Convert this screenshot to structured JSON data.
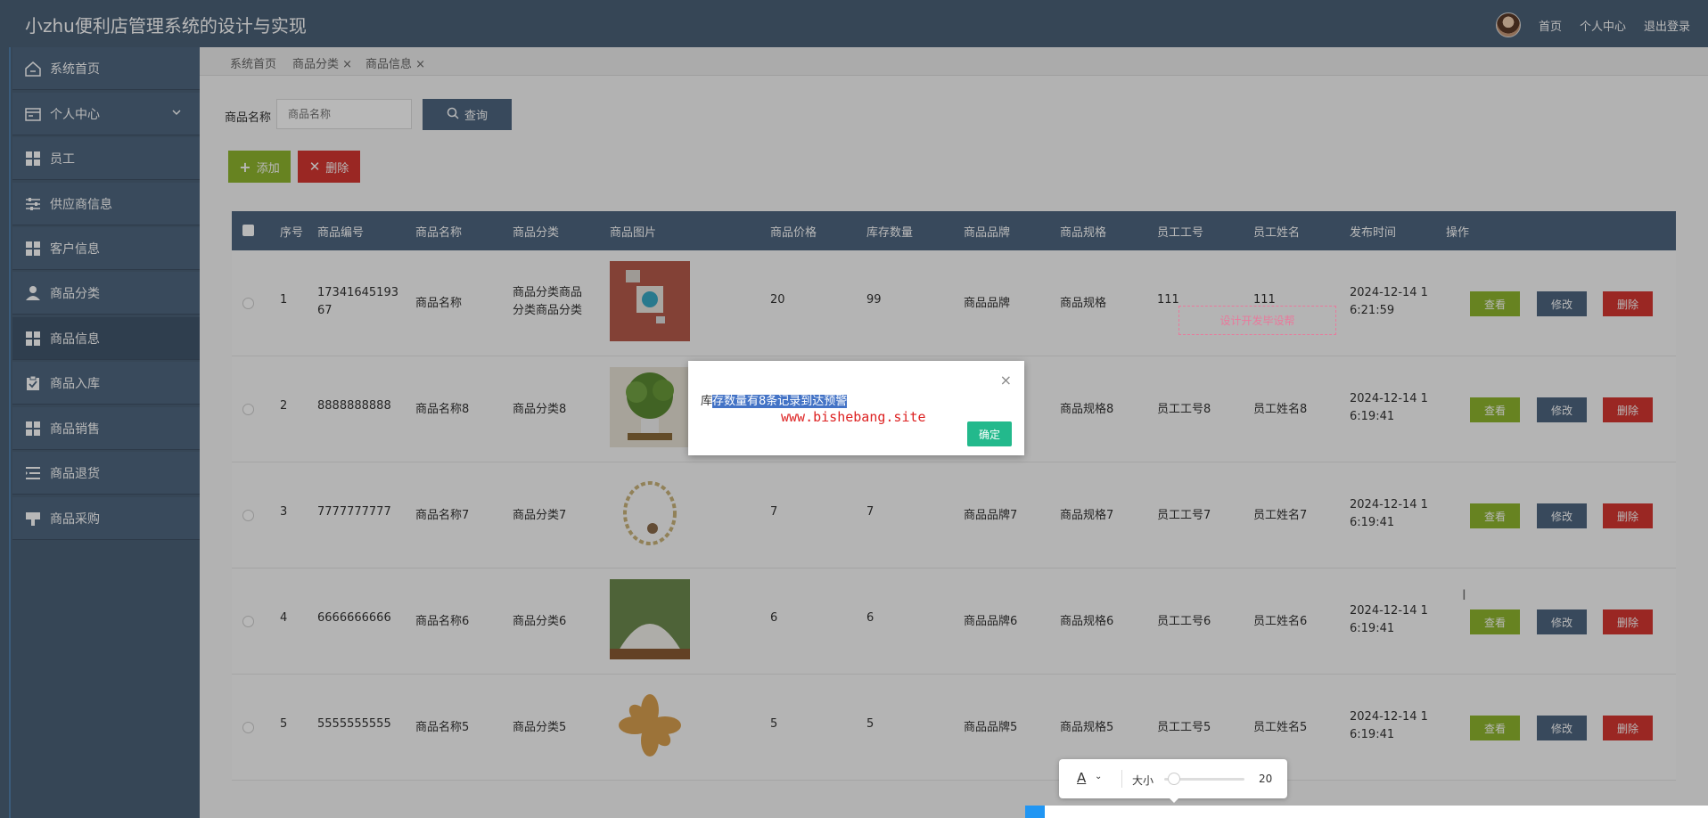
{
  "app_title": "小zhu便利店管理系统的设计与实现",
  "header_links": [
    "首页",
    "个人中心",
    "退出登录"
  ],
  "sidebar": {
    "items": [
      {
        "label": "系统首页",
        "icon": "home-icon"
      },
      {
        "label": "个人中心",
        "icon": "card-icon"
      },
      {
        "label": "员工",
        "icon": "grid-icon"
      },
      {
        "label": "供应商信息",
        "icon": "sliders-icon"
      },
      {
        "label": "客户信息",
        "icon": "grid-icon"
      },
      {
        "label": "商品分类",
        "icon": "user-icon"
      },
      {
        "label": "商品信息",
        "icon": "grid-icon"
      },
      {
        "label": "商品入库",
        "icon": "clipboard-icon"
      },
      {
        "label": "商品销售",
        "icon": "grid-icon"
      },
      {
        "label": "商品退货",
        "icon": "list-icon"
      },
      {
        "label": "商品采购",
        "icon": "sign-icon"
      }
    ]
  },
  "tabs": [
    "系统首页",
    "商品分类 ×",
    "商品信息 ×"
  ],
  "search": {
    "label": "商品名称",
    "placeholder": "商品名称",
    "button": "查询"
  },
  "actions": {
    "add": "添加",
    "delete": "删除"
  },
  "table": {
    "headers": [
      "序号",
      "商品编号",
      "商品名称",
      "商品分类",
      "商品图片",
      "商品价格",
      "库存数量",
      "商品品牌",
      "商品规格",
      "员工工号",
      "员工姓名",
      "发布时间",
      "操作"
    ],
    "row_buttons": {
      "view": "查看",
      "edit": "修改",
      "delete": "删除"
    },
    "rows": [
      {
        "no": "1",
        "code": "1734164519367",
        "name": "商品名称",
        "category": "商品分类商品分类商品分类",
        "price": "20",
        "stock": "99",
        "brand": "商品品牌",
        "spec": "商品规格",
        "emp_no": "111",
        "emp_name": "111",
        "time": "2024-12-14 16:21:59"
      },
      {
        "no": "2",
        "code": "8888888888",
        "name": "商品名称8",
        "category": "商品分类8",
        "price": "",
        "stock": "",
        "brand": "",
        "spec": "商品规格8",
        "emp_no": "员工工号8",
        "emp_name": "员工姓名8",
        "time": "2024-12-14 16:19:41"
      },
      {
        "no": "3",
        "code": "7777777777",
        "name": "商品名称7",
        "category": "商品分类7",
        "price": "7",
        "stock": "7",
        "brand": "商品品牌7",
        "spec": "商品规格7",
        "emp_no": "员工工号7",
        "emp_name": "员工姓名7",
        "time": "2024-12-14 16:19:41"
      },
      {
        "no": "4",
        "code": "6666666666",
        "name": "商品名称6",
        "category": "商品分类6",
        "price": "6",
        "stock": "6",
        "brand": "商品品牌6",
        "spec": "商品规格6",
        "emp_no": "员工工号6",
        "emp_name": "员工姓名6",
        "time": "2024-12-14 16:19:41"
      },
      {
        "no": "5",
        "code": "5555555555",
        "name": "商品名称5",
        "category": "商品分类5",
        "price": "5",
        "stock": "5",
        "brand": "商品品牌5",
        "spec": "商品规格5",
        "emp_no": "员工工号5",
        "emp_name": "员工姓名5",
        "time": "2024-12-14 16:19:41"
      }
    ]
  },
  "watermark": "设计开发毕设帮",
  "dialog": {
    "message_prefix": "库",
    "message_highlight": "存数量有8条记录到达预警",
    "site": "www.bishebang.site",
    "ok": "确定",
    "close": "×"
  },
  "fontbar": {
    "letter": "A",
    "size_label": "大小",
    "size_value": "20"
  }
}
